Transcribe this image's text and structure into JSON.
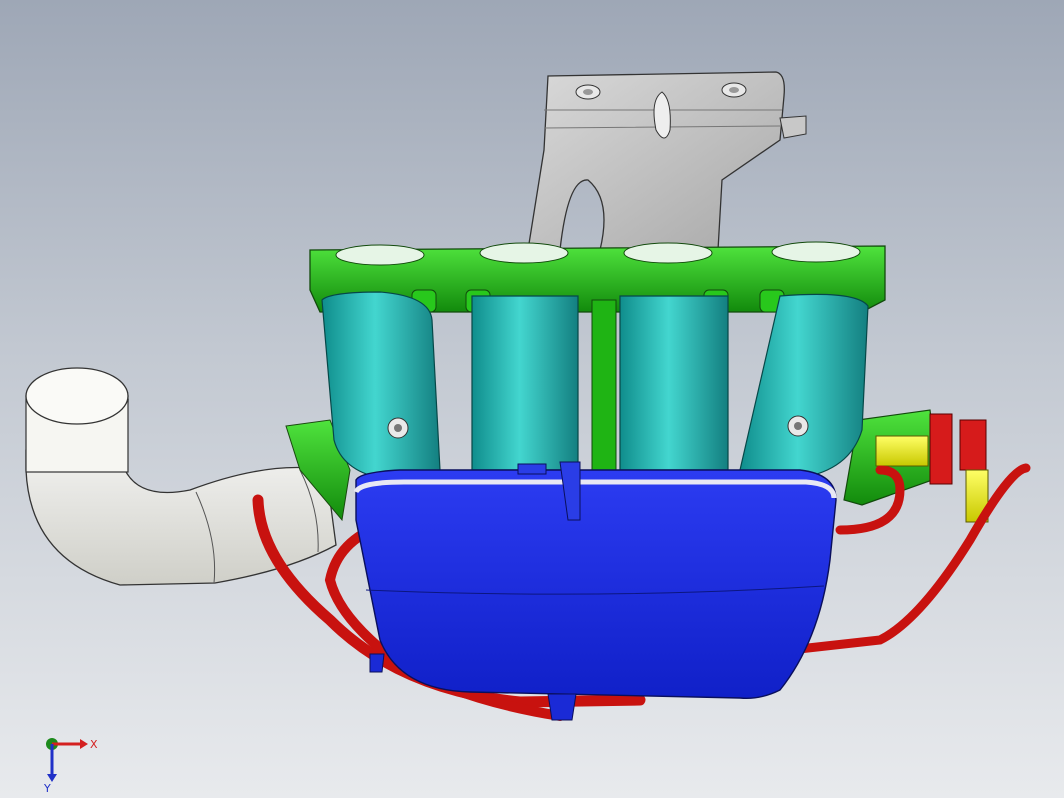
{
  "viewport": {
    "background_top": "#9ea7b6",
    "background_bottom": "#e8eaed"
  },
  "model": {
    "parts": [
      {
        "name": "mounting-bracket",
        "color": "#cfcfcf"
      },
      {
        "name": "manifold-flange",
        "color": "#1fbf14"
      },
      {
        "name": "intake-runners",
        "color": "#27c7c0"
      },
      {
        "name": "plenum",
        "color": "#1f2ee6"
      },
      {
        "name": "air-inlet-elbow",
        "color": "#f2f2ee"
      },
      {
        "name": "vacuum-hoses",
        "color": "#c8120f"
      },
      {
        "name": "throttle-connector",
        "color": "#e4e400"
      }
    ]
  },
  "triad": {
    "x_label": "X",
    "y_label": "Y",
    "x_color": "#d42020",
    "y_color": "#1c8a1c",
    "z_color": "#2030c8",
    "icon": "coordinate-axes-icon"
  }
}
